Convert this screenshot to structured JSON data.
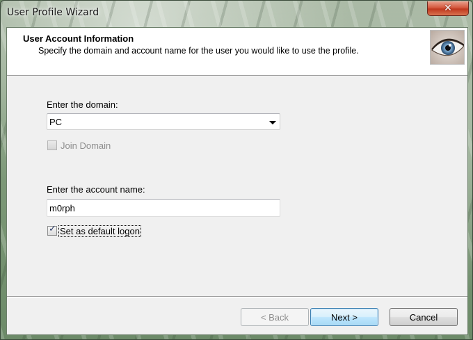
{
  "window": {
    "title": "User Profile Wizard",
    "close_glyph": "✕"
  },
  "header": {
    "title": "User Account Information",
    "subtitle": "Specify the domain and account name for the user you would like to use the profile.",
    "icon": "eye-icon"
  },
  "form": {
    "domain_label": "Enter the domain:",
    "domain_value": "PC",
    "join_domain_label": "Join Domain",
    "join_domain_checked": false,
    "join_domain_enabled": false,
    "account_label": "Enter the account name:",
    "account_value": "m0rph",
    "default_logon_label": "Set as default logon",
    "default_logon_checked": true,
    "check_glyph": "✓"
  },
  "buttons": {
    "back": "< Back",
    "next": "Next >",
    "cancel": "Cancel"
  },
  "colors": {
    "accent_default_button": "#3c7fb1",
    "close_button": "#c0391f",
    "client_background": "#f0f0f0"
  }
}
